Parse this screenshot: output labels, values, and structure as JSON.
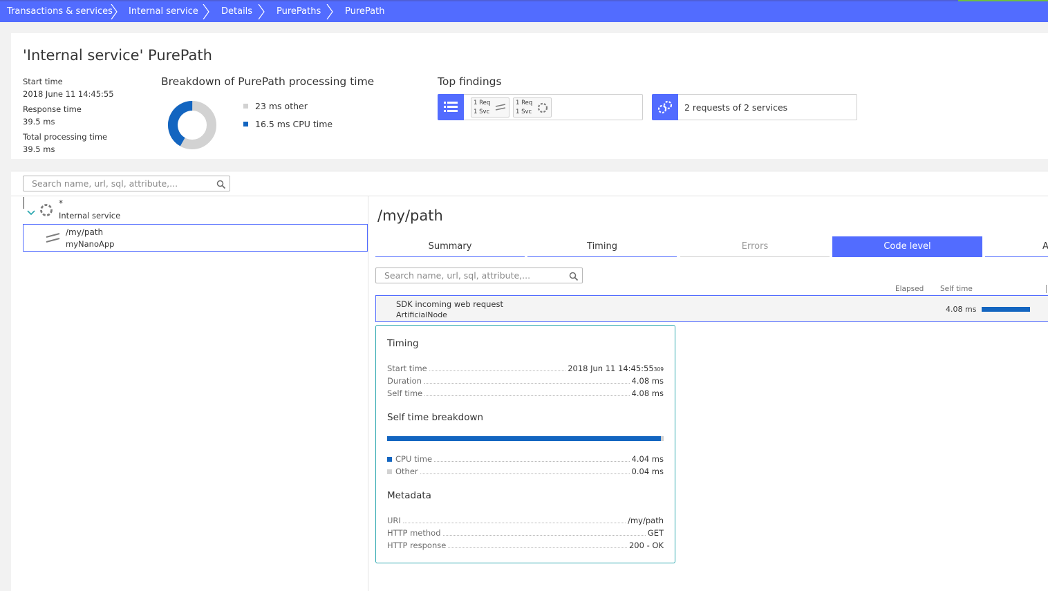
{
  "breadcrumb": [
    "Transactions & services",
    "Internal service",
    "Details",
    "PurePaths",
    "PurePath"
  ],
  "header": {
    "title": "'Internal service' PurePath",
    "start_time_label": "Start time",
    "start_time_value": "2018 June 11 14:45:55",
    "response_time_label": "Response time",
    "response_time_value": "39.5 ms",
    "total_time_label": "Total processing time",
    "total_time_value": "39.5 ms",
    "breakdown_title": "Breakdown of PurePath processing time",
    "breakdown": {
      "other_label": "23 ms other",
      "cpu_label": "16.5 ms CPU time",
      "other_value_ms": 23,
      "cpu_value_ms": 16.5,
      "other_color": "#d2d2d2",
      "cpu_color": "#1365c0"
    },
    "findings_title": "Top findings",
    "finding1": {
      "icon": "list-icon",
      "chip1_line1": "1 Req",
      "chip1_line2": "1 Svc",
      "chip1_icon": "web-request-icon",
      "chip2_line1": "1 Req",
      "chip2_line2": "1 Svc",
      "chip2_icon": "service-icon"
    },
    "finding2": {
      "icon": "services-link-icon",
      "text": "2 requests of 2 services"
    }
  },
  "tree": {
    "search_placeholder": "Search name, url, sql, attribute,...",
    "root": {
      "name": "*",
      "sub": "Internal service",
      "icon": "service-icon",
      "expand_icon": "chevron-down-icon"
    },
    "child": {
      "name": "/my/path",
      "sub": "myNanoApp",
      "icon": "web-request-icon"
    }
  },
  "detail": {
    "title": "/my/path",
    "tabs": [
      "Summary",
      "Timing",
      "Errors",
      "Code level",
      "A"
    ],
    "active_tab": "Code level",
    "search_placeholder": "Search name, url, sql, attribute,...",
    "col_elapsed": "Elapsed",
    "col_self_time": "Self time",
    "method": {
      "name": "SDK incoming web request",
      "sub": "ArtificialNode",
      "self_time": "4.08 ms"
    },
    "panel": {
      "timing_title": "Timing",
      "start_time_label": "Start time",
      "start_time_value": "2018 Jun 11 14:45:55",
      "start_time_ms": "309",
      "duration_label": "Duration",
      "duration_value": "4.08 ms",
      "self_time_label": "Self time",
      "self_time_value": "4.08 ms",
      "breakdown_title": "Self time breakdown",
      "cpu_fraction": 0.99,
      "cpu_label": "CPU time",
      "cpu_value": "4.04 ms",
      "other_label": "Other",
      "other_value": "0.04 ms",
      "metadata_title": "Metadata",
      "uri_label": "URI",
      "uri_value": "/my/path",
      "method_label": "HTTP method",
      "method_value": "GET",
      "response_label": "HTTP response",
      "response_value": "200 - OK"
    }
  },
  "colors": {
    "brand": "#526cff",
    "cpu": "#1365c0",
    "teal_border": "#2fa9b0"
  }
}
